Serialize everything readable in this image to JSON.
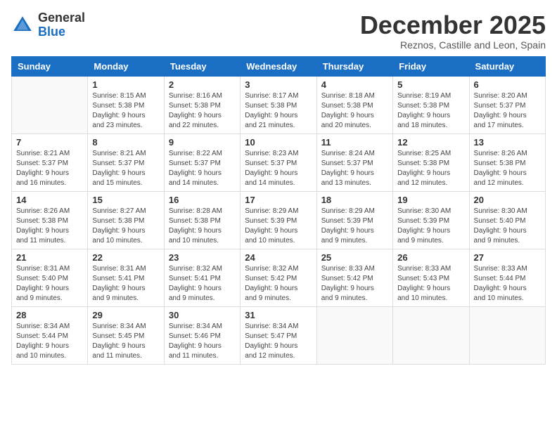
{
  "logo": {
    "general": "General",
    "blue": "Blue"
  },
  "title": "December 2025",
  "location": "Reznos, Castille and Leon, Spain",
  "weekdays": [
    "Sunday",
    "Monday",
    "Tuesday",
    "Wednesday",
    "Thursday",
    "Friday",
    "Saturday"
  ],
  "weeks": [
    [
      {
        "day": "",
        "info": ""
      },
      {
        "day": "1",
        "info": "Sunrise: 8:15 AM\nSunset: 5:38 PM\nDaylight: 9 hours\nand 23 minutes."
      },
      {
        "day": "2",
        "info": "Sunrise: 8:16 AM\nSunset: 5:38 PM\nDaylight: 9 hours\nand 22 minutes."
      },
      {
        "day": "3",
        "info": "Sunrise: 8:17 AM\nSunset: 5:38 PM\nDaylight: 9 hours\nand 21 minutes."
      },
      {
        "day": "4",
        "info": "Sunrise: 8:18 AM\nSunset: 5:38 PM\nDaylight: 9 hours\nand 20 minutes."
      },
      {
        "day": "5",
        "info": "Sunrise: 8:19 AM\nSunset: 5:38 PM\nDaylight: 9 hours\nand 18 minutes."
      },
      {
        "day": "6",
        "info": "Sunrise: 8:20 AM\nSunset: 5:37 PM\nDaylight: 9 hours\nand 17 minutes."
      }
    ],
    [
      {
        "day": "7",
        "info": "Sunrise: 8:21 AM\nSunset: 5:37 PM\nDaylight: 9 hours\nand 16 minutes."
      },
      {
        "day": "8",
        "info": "Sunrise: 8:21 AM\nSunset: 5:37 PM\nDaylight: 9 hours\nand 15 minutes."
      },
      {
        "day": "9",
        "info": "Sunrise: 8:22 AM\nSunset: 5:37 PM\nDaylight: 9 hours\nand 14 minutes."
      },
      {
        "day": "10",
        "info": "Sunrise: 8:23 AM\nSunset: 5:37 PM\nDaylight: 9 hours\nand 14 minutes."
      },
      {
        "day": "11",
        "info": "Sunrise: 8:24 AM\nSunset: 5:37 PM\nDaylight: 9 hours\nand 13 minutes."
      },
      {
        "day": "12",
        "info": "Sunrise: 8:25 AM\nSunset: 5:38 PM\nDaylight: 9 hours\nand 12 minutes."
      },
      {
        "day": "13",
        "info": "Sunrise: 8:26 AM\nSunset: 5:38 PM\nDaylight: 9 hours\nand 12 minutes."
      }
    ],
    [
      {
        "day": "14",
        "info": "Sunrise: 8:26 AM\nSunset: 5:38 PM\nDaylight: 9 hours\nand 11 minutes."
      },
      {
        "day": "15",
        "info": "Sunrise: 8:27 AM\nSunset: 5:38 PM\nDaylight: 9 hours\nand 10 minutes."
      },
      {
        "day": "16",
        "info": "Sunrise: 8:28 AM\nSunset: 5:38 PM\nDaylight: 9 hours\nand 10 minutes."
      },
      {
        "day": "17",
        "info": "Sunrise: 8:29 AM\nSunset: 5:39 PM\nDaylight: 9 hours\nand 10 minutes."
      },
      {
        "day": "18",
        "info": "Sunrise: 8:29 AM\nSunset: 5:39 PM\nDaylight: 9 hours\nand 9 minutes."
      },
      {
        "day": "19",
        "info": "Sunrise: 8:30 AM\nSunset: 5:39 PM\nDaylight: 9 hours\nand 9 minutes."
      },
      {
        "day": "20",
        "info": "Sunrise: 8:30 AM\nSunset: 5:40 PM\nDaylight: 9 hours\nand 9 minutes."
      }
    ],
    [
      {
        "day": "21",
        "info": "Sunrise: 8:31 AM\nSunset: 5:40 PM\nDaylight: 9 hours\nand 9 minutes."
      },
      {
        "day": "22",
        "info": "Sunrise: 8:31 AM\nSunset: 5:41 PM\nDaylight: 9 hours\nand 9 minutes."
      },
      {
        "day": "23",
        "info": "Sunrise: 8:32 AM\nSunset: 5:41 PM\nDaylight: 9 hours\nand 9 minutes."
      },
      {
        "day": "24",
        "info": "Sunrise: 8:32 AM\nSunset: 5:42 PM\nDaylight: 9 hours\nand 9 minutes."
      },
      {
        "day": "25",
        "info": "Sunrise: 8:33 AM\nSunset: 5:42 PM\nDaylight: 9 hours\nand 9 minutes."
      },
      {
        "day": "26",
        "info": "Sunrise: 8:33 AM\nSunset: 5:43 PM\nDaylight: 9 hours\nand 10 minutes."
      },
      {
        "day": "27",
        "info": "Sunrise: 8:33 AM\nSunset: 5:44 PM\nDaylight: 9 hours\nand 10 minutes."
      }
    ],
    [
      {
        "day": "28",
        "info": "Sunrise: 8:34 AM\nSunset: 5:44 PM\nDaylight: 9 hours\nand 10 minutes."
      },
      {
        "day": "29",
        "info": "Sunrise: 8:34 AM\nSunset: 5:45 PM\nDaylight: 9 hours\nand 11 minutes."
      },
      {
        "day": "30",
        "info": "Sunrise: 8:34 AM\nSunset: 5:46 PM\nDaylight: 9 hours\nand 11 minutes."
      },
      {
        "day": "31",
        "info": "Sunrise: 8:34 AM\nSunset: 5:47 PM\nDaylight: 9 hours\nand 12 minutes."
      },
      {
        "day": "",
        "info": ""
      },
      {
        "day": "",
        "info": ""
      },
      {
        "day": "",
        "info": ""
      }
    ]
  ]
}
